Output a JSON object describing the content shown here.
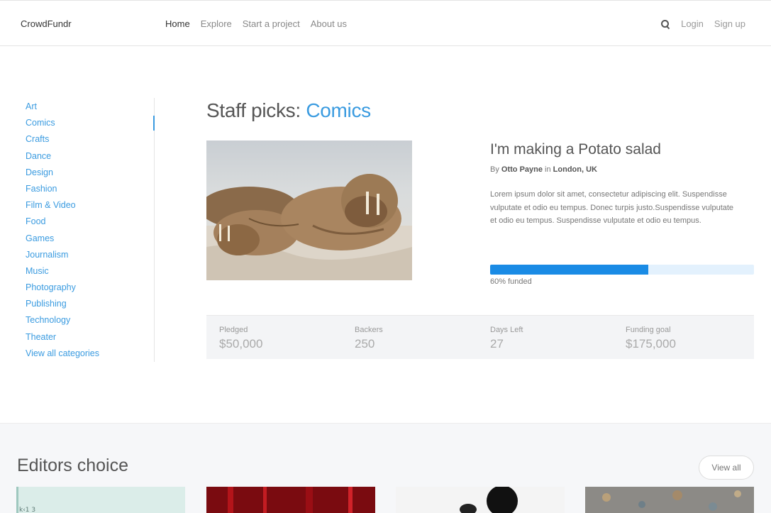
{
  "nav": {
    "brand": "CrowdFundr",
    "links": [
      "Home",
      "Explore",
      "Start a project",
      "About us"
    ],
    "login": "Login",
    "signup": "Sign up"
  },
  "sidebar": {
    "items": [
      "Art",
      "Comics",
      "Crafts",
      "Dance",
      "Design",
      "Fashion",
      "Film & Video",
      "Food",
      "Games",
      "Journalism",
      "Music",
      "Photography",
      "Publishing",
      "Technology",
      "Theater",
      "View all categories"
    ],
    "active": "Comics"
  },
  "main": {
    "title_prefix": "Staff picks: ",
    "title_accent": "Comics"
  },
  "project": {
    "title": "I'm making a Potato salad",
    "by_label": "By",
    "author": "Otto Payne",
    "in_label": "in",
    "location": "London, UK",
    "description": "Lorem ipsum dolor sit amet, consectetur adipiscing elit. Suspendisse vulputate et odio eu tempus. Donec turpis justo.Suspendisse vulputate et odio eu tempus. Suspendisse vulputate et odio eu tempus.",
    "funded_percent": 60,
    "funded_text": "60% funded"
  },
  "stats": [
    {
      "label": "Pledged",
      "value": "$50,000"
    },
    {
      "label": "Backers",
      "value": "250"
    },
    {
      "label": "Days Left",
      "value": "27"
    },
    {
      "label": "Funding goal",
      "value": "$175,000"
    }
  ],
  "editors": {
    "title": "Editors choice",
    "view_all": "View all"
  },
  "colors": {
    "accent": "#3a9be0",
    "progress": "#1a8be5"
  }
}
